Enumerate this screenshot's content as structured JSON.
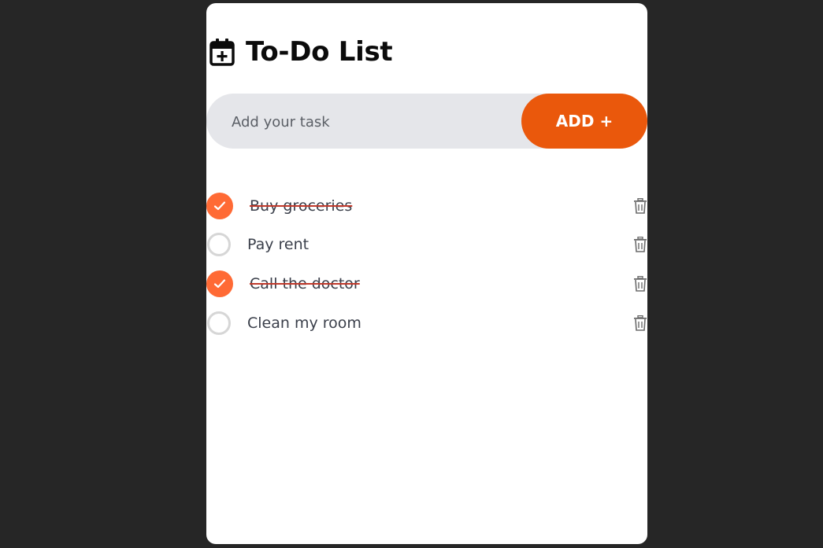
{
  "app": {
    "title": "To-Do List"
  },
  "new_task": {
    "placeholder": "Add your task",
    "value": "",
    "add_label": "ADD +"
  },
  "tasks": [
    {
      "text": "Buy groceries",
      "done": true
    },
    {
      "text": "Pay rent",
      "done": false
    },
    {
      "text": "Call the doctor",
      "done": true
    },
    {
      "text": "Clean my room",
      "done": false
    }
  ],
  "colors": {
    "background": "#262626",
    "accent": "#ea580c",
    "check_done": "#ff6a35",
    "strike": "#c0392b"
  },
  "icons": {
    "header": "calendar-plus-icon",
    "checked": "checkmark-icon",
    "delete": "trash-icon"
  }
}
